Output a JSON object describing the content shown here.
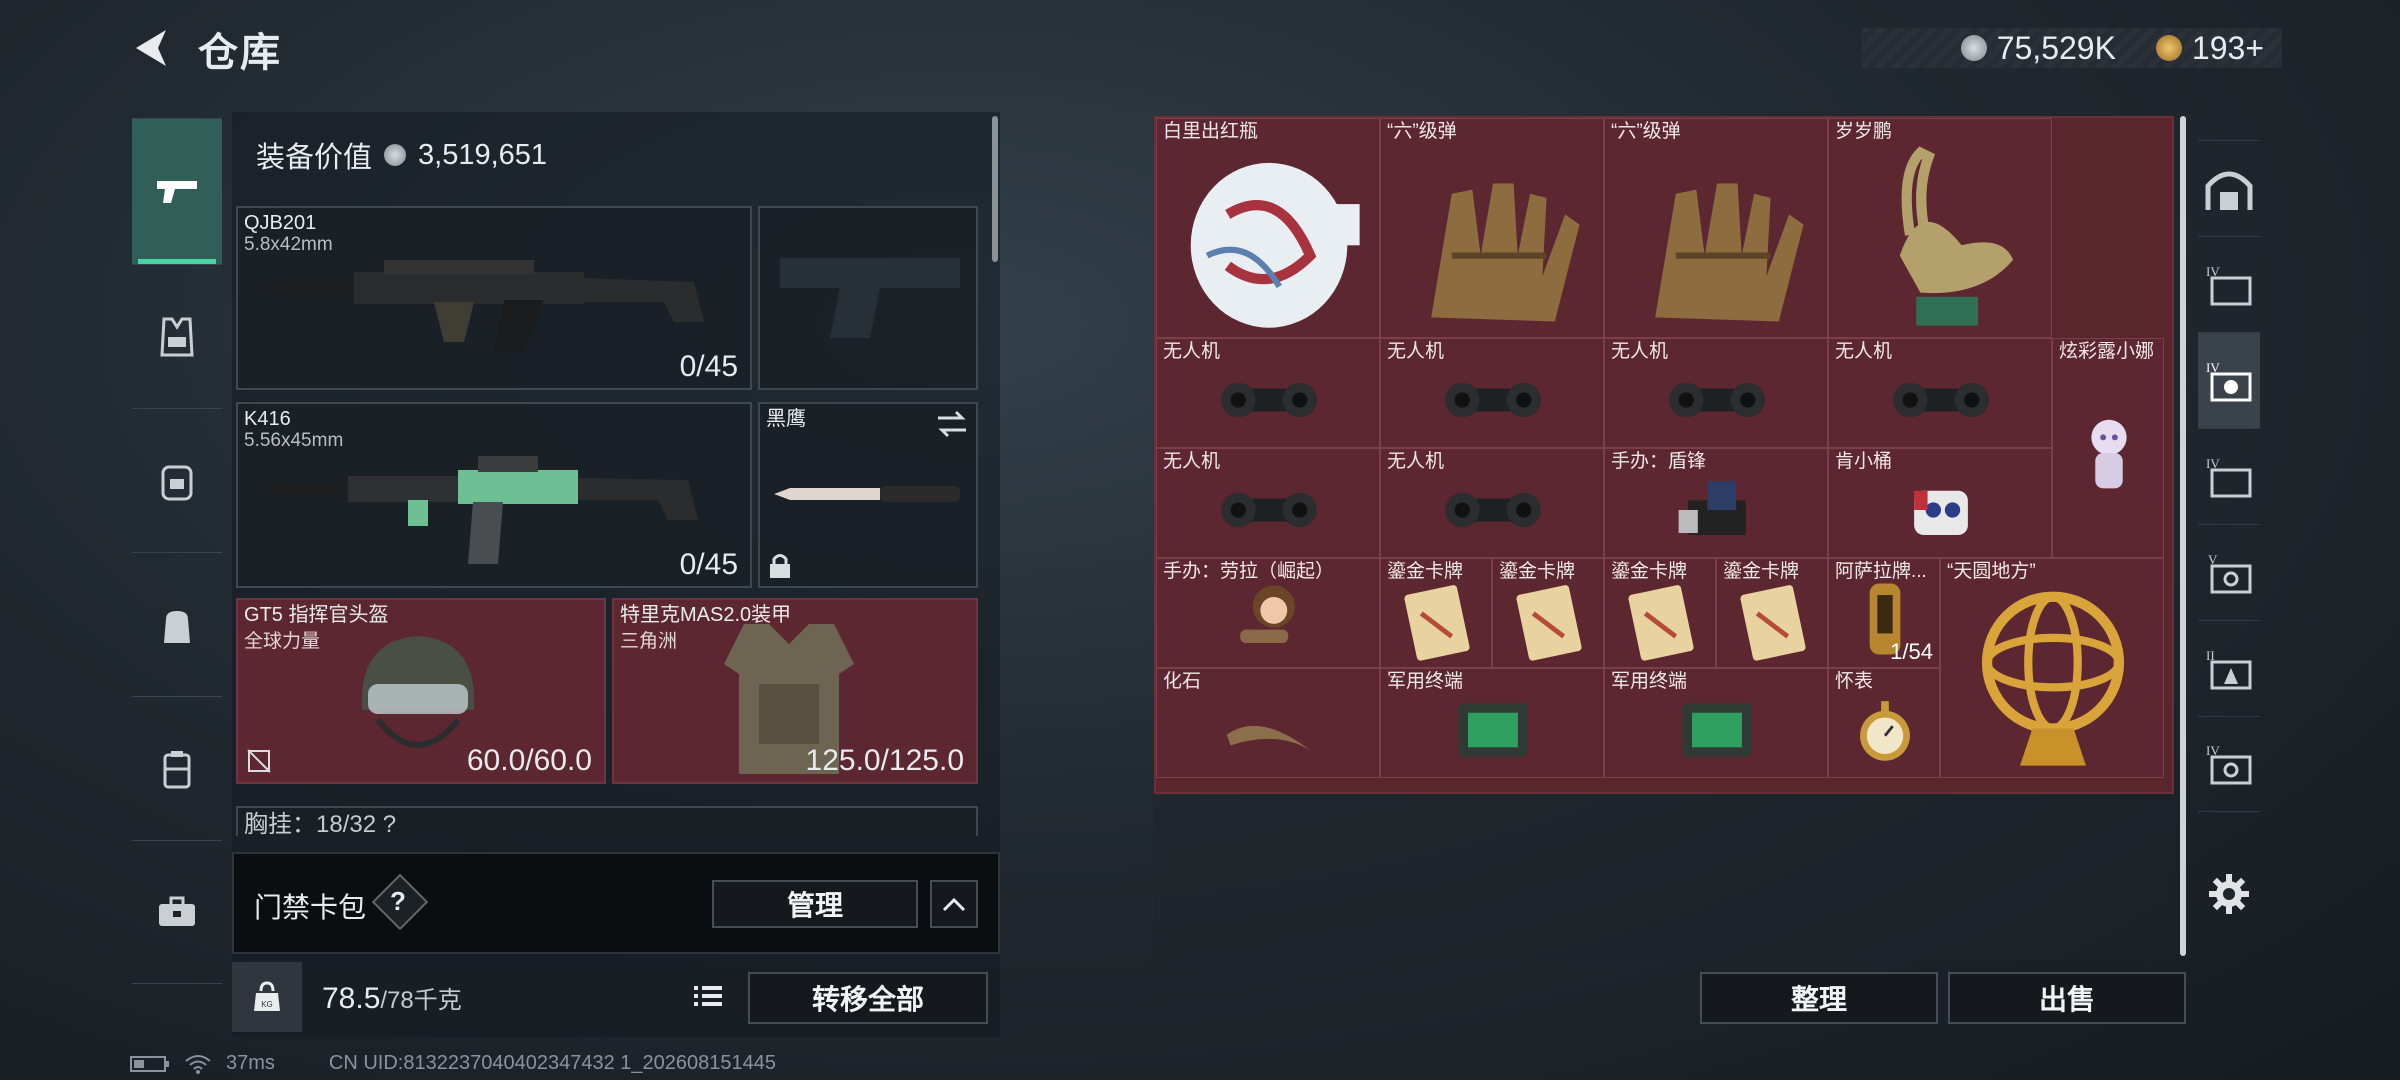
{
  "header": {
    "title": "仓库",
    "currency_a": "75,529K",
    "currency_b": "193+"
  },
  "equip": {
    "value_label": "装备价值",
    "value": "3,519,651",
    "weapon1": {
      "name": "QJB201",
      "caliber": "5.8x42mm",
      "ammo": "0/45"
    },
    "weapon2": {
      "name": "K416",
      "caliber": "5.56x45mm",
      "ammo": "0/45"
    },
    "melee": {
      "name": "黑鹰"
    },
    "helmet": {
      "name": "GT5 指挥官头盔",
      "sub": "全球力量",
      "durability": "60.0/60.0"
    },
    "armor": {
      "name": "特里克MAS2.0装甲",
      "sub": "三角洲",
      "durability": "125.0/125.0"
    },
    "chest_partial": "胸挂：18/32 ?"
  },
  "cardbag": {
    "label": "门禁卡包",
    "help": "?",
    "manage": "管理"
  },
  "weight": {
    "current": "78.5",
    "max": "/78千克",
    "transfer": "转移全部"
  },
  "stash": {
    "items": [
      {
        "label": "白里出红瓶",
        "icon": "vase-icon"
      },
      {
        "label": "“六”级弹",
        "icon": "hand-statue-icon"
      },
      {
        "label": "“六”级弹",
        "icon": "hand-statue-icon"
      },
      {
        "label": "岁岁鹏",
        "icon": "bird-statue-icon"
      },
      {
        "label": "无人机",
        "icon": "drone-motor-icon"
      },
      {
        "label": "无人机",
        "icon": "drone-motor-icon"
      },
      {
        "label": "无人机",
        "icon": "drone-motor-icon"
      },
      {
        "label": "无人机",
        "icon": "drone-motor-icon"
      },
      {
        "label": "炫彩露小娜",
        "icon": "figurine-icon"
      },
      {
        "label": "无人机",
        "icon": "drone-motor-icon"
      },
      {
        "label": "无人机",
        "icon": "drone-motor-icon"
      },
      {
        "label": "手办：盾锋",
        "icon": "figure-icon"
      },
      {
        "label": "肯小桶",
        "icon": "robot-icon"
      },
      {
        "label": "手办：劳拉（崛起）",
        "icon": "doll-icon"
      },
      {
        "label": "鎏金卡牌",
        "icon": "card-icon"
      },
      {
        "label": "鎏金卡牌",
        "icon": "card-icon"
      },
      {
        "label": "鎏金卡牌",
        "icon": "card-icon"
      },
      {
        "label": "鎏金卡牌",
        "icon": "card-icon"
      },
      {
        "label": "阿萨拉牌...",
        "icon": "plaque-icon",
        "count": "1/54"
      },
      {
        "label": "“天圆地方”",
        "icon": "armillary-icon"
      },
      {
        "label": "化石",
        "icon": "fossil-icon"
      },
      {
        "label": "军用终端",
        "icon": "terminal-icon"
      },
      {
        "label": "军用终端",
        "icon": "terminal-icon"
      },
      {
        "label": "怀表",
        "icon": "pocket-watch-icon"
      }
    ],
    "sort": "整理",
    "sell": "出售"
  },
  "status": {
    "ping": "37ms",
    "uid": "CN UID:8132237040402347432 1_202608151445"
  }
}
